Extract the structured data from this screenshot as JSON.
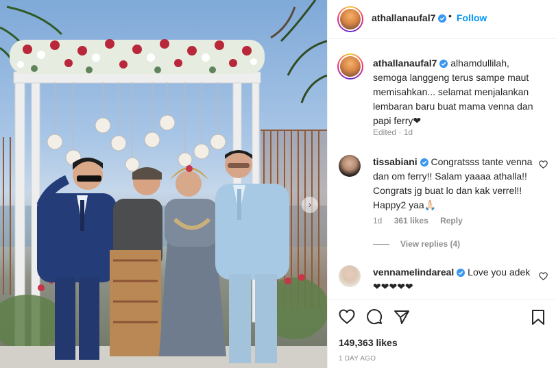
{
  "post": {
    "author": "athallanaufal7",
    "follow_label": "Follow",
    "separator": "•",
    "slide_next_icon": "chevron-right-icon"
  },
  "caption": {
    "author": "athallanaufal7",
    "text": "alhamdullilah, semoga langgeng terus sampe maut memisahkan... selamat menjalankan lembaran baru buat mama venna dan papi ferry❤",
    "meta": "Edited · 1d"
  },
  "comments": [
    {
      "author": "tissabiani",
      "text": "Congratsss tante venna dan om ferry!! Salam yaaaa athalla!! Congrats jg buat lo dan kak verrel!! Happy2 yaa🙏🏻",
      "age": "1d",
      "likes": "361 likes",
      "reply_label": "Reply",
      "view_replies": "View replies (4)"
    },
    {
      "author": "vennamelindareal",
      "text": "Love you adek ❤❤❤❤❤"
    }
  ],
  "footer": {
    "likes": "149,363 likes",
    "date": "1 DAY AGO"
  },
  "colors": {
    "link_blue": "#0095f6",
    "verified_blue": "#3897f0",
    "secondary_text": "#8e8e8e",
    "border": "#efefef"
  }
}
